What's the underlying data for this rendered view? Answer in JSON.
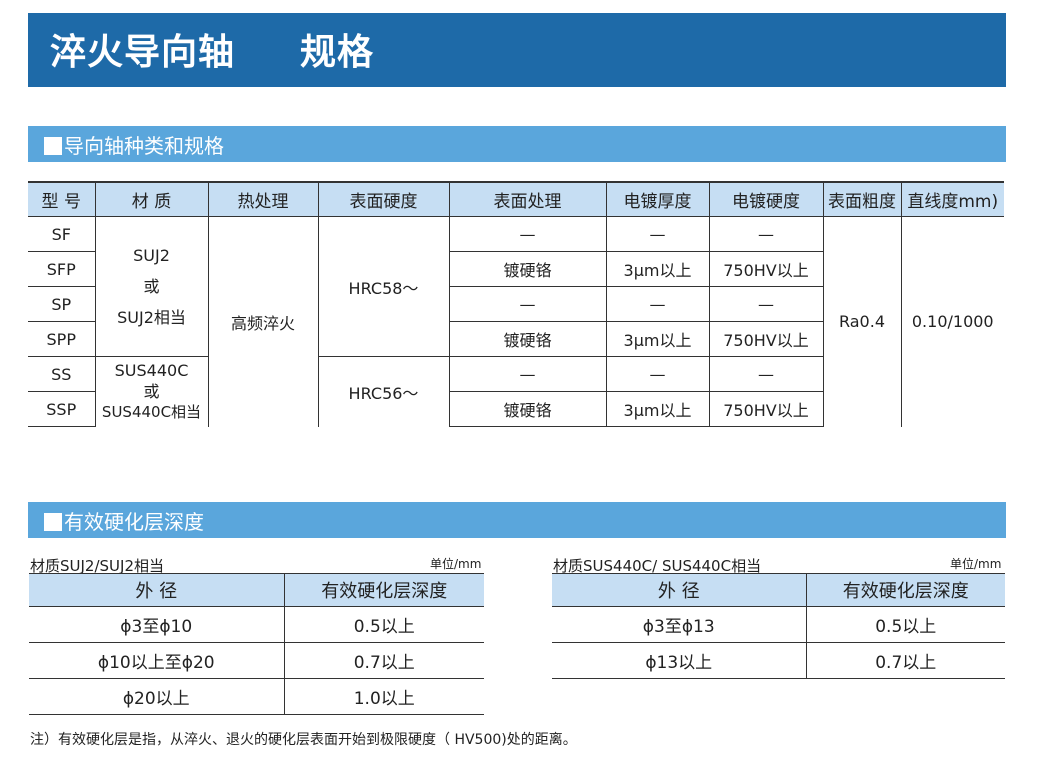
{
  "banner": {
    "title": "淬火导向轴",
    "subtitle": "规格"
  },
  "section1": {
    "title": "导向轴种类和规格"
  },
  "spec_table": {
    "headers": [
      "型 号",
      "材 质",
      "热处理",
      "表面硬度",
      "表面处理",
      "电镀厚度",
      "电镀硬度",
      "表面粗度",
      "直线度mm)"
    ],
    "models": [
      "SF",
      "SFP",
      "SP",
      "SPP",
      "SS",
      "SSP"
    ],
    "material_a": {
      "line1": "SUJ2",
      "line2": "或",
      "line3": "SUJ2相当"
    },
    "material_b": {
      "line1": "SUS440C",
      "line2": "或",
      "line3": "SUS440C相当"
    },
    "heat_treatment": "高频淬火",
    "hardness_a": "HRC58～",
    "hardness_b": "HRC56～",
    "dash": "—",
    "treatment": "镀硬铬",
    "thickness": "3μm以上",
    "plating_hardness": "750HV以上",
    "roughness": "Ra0.4",
    "straightness": "0.10/1000"
  },
  "section2": {
    "title": "有效硬化层深度"
  },
  "hard_left": {
    "caption": "材质SUJ2/SUJ2相当",
    "unit": "单位/mm",
    "headers": [
      "外 径",
      "有效硬化层深度"
    ],
    "rows": [
      {
        "dia": "ϕ3至ϕ10",
        "depth": "0.5以上"
      },
      {
        "dia": "ϕ10以上至ϕ20",
        "depth": "0.7以上"
      },
      {
        "dia": "ϕ20以上",
        "depth": "1.0以上"
      }
    ]
  },
  "hard_right": {
    "caption": "材质SUS440C/ SUS440C相当",
    "unit": "单位/mm",
    "headers": [
      "外 径",
      "有效硬化层深度"
    ],
    "rows": [
      {
        "dia": "ϕ3至ϕ13",
        "depth": "0.5以上"
      },
      {
        "dia": "ϕ13以上",
        "depth": "0.7以上"
      }
    ]
  },
  "note": "注）有效硬化层是指，从淬火、退火的硬化层表面开始到极限硬度（ HV500)处的距离。"
}
